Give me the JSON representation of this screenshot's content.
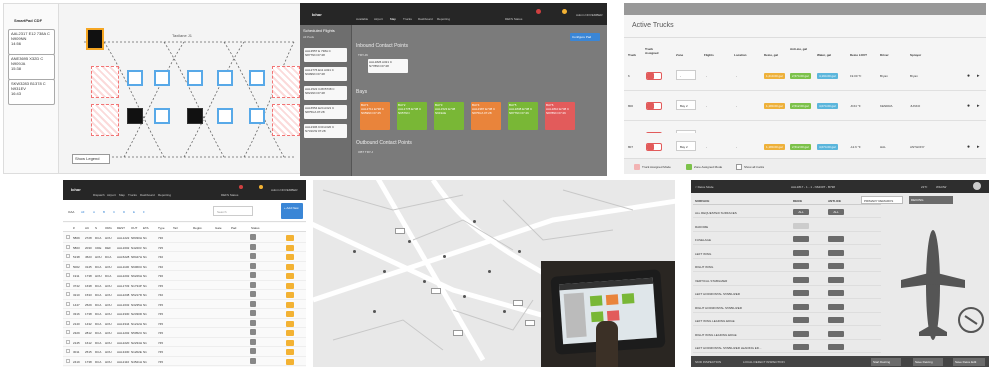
{
  "p1": {
    "title": "SmartPad CDF",
    "cards": [
      {
        "l1": "AAL2317 E12 738A C",
        "l2": "N909NN",
        "l3": "14:56"
      },
      {
        "l1": "ANE3695 X32D C",
        "l2": "N909JA",
        "l3": "15:38"
      },
      {
        "l1": "SKW3283 B1378 C",
        "l2": "N931EV",
        "l3": "16:43"
      }
    ],
    "taxi": "Taxilane J1",
    "legend": "Show Legend"
  },
  "p2": {
    "brand": "Ichor",
    "nav": [
      "Available",
      "Airport",
      "Map",
      "Trucks",
      "Dashboard",
      "Reporting"
    ],
    "user": "Admin NOVEMBER",
    "status": "DEFS Status",
    "sched_title": "Scheduled Flights",
    "sched_sub": "All Pads",
    "flights": [
      {
        "a": "AAL3557 E 738A C",
        "b": "N877NN 07:28"
      },
      {
        "a": "AAL2776 E11 A321 C",
        "b": "N909NN 07:28"
      },
      {
        "a": "AAL1522 C28 B738 C",
        "b": "N821NN 07:28"
      },
      {
        "a": "AAL6554 E24 A321 C",
        "b": "N875UA 07:28"
      },
      {
        "a": "AAL2306 K30 A320 C",
        "b": "N731UW 07:28"
      }
    ],
    "inbound": "Inbound Contact Points",
    "cp": "TRY-J6",
    "cp_card": {
      "a": "AAL1826 A321 C",
      "b": "N778NN 07:28"
    },
    "bays_title": "Bays",
    "bays": [
      {
        "name": "BAY1",
        "a": "AAL2711 E738 C",
        "b": "N959NN 07:25",
        "color": "#e9843b"
      },
      {
        "name": "BAY2",
        "a": "AAL1778 E738 C",
        "b": "N957NN",
        "color": "#79b736"
      },
      {
        "name": "BAY3",
        "a": "AAL1523 E738",
        "b": "N919AE",
        "color": "#79b736"
      },
      {
        "name": "BAY4",
        "a": "AAL2387 E738 C",
        "b": "N875UA 07:28",
        "color": "#e9843b"
      },
      {
        "name": "BAY5",
        "a": "AAL1838 E738 C",
        "b": "N877NN 07:26",
        "color": "#79b736"
      },
      {
        "name": "BAY6",
        "a": "AAL1810 E738 C",
        "b": "N878NN 07:26",
        "color": "#e25b5b"
      }
    ],
    "outbound": "Outbound Contact Points",
    "out_cp": "OBT TRY-J",
    "config": "Configure Pad"
  },
  "p3": {
    "title": "Active Trucks",
    "headers": [
      "Truck",
      "Truck Assigned",
      "Zone",
      "Flights",
      "Location",
      "Deice, gal",
      "Anti-ice, gal",
      "Water, gal",
      "Deice LOUT",
      "Driver",
      "Sprayer"
    ],
    "rows": [
      {
        "truck": "6",
        "zone": "-",
        "flights": "-",
        "location": "-",
        "deice": "1,210.00 gal",
        "anti": "2,574.00 gal",
        "water": "4,194.00 gal",
        "lout": "19.00 °F",
        "driver": "Bryan",
        "sprayer": "Bryan"
      },
      {
        "truck": "800",
        "zone": "Bay 2",
        "flights": "-",
        "location": "-",
        "deice": "1,180.00 gal",
        "anti": "2,512.00 gal",
        "water": "4,074.00 gal",
        "lout": "-8.64 °F",
        "driver": "KENDRA",
        "sprayer": "JUNKO"
      },
      {
        "truck": "805",
        "zone": "Bay 2",
        "flights": "-",
        "location": "-",
        "deice": "1,180.00 gal",
        "anti": "2,512.00 gal",
        "water": "4,074.00 gal",
        "lout": "-12.6 °F",
        "driver": "JJ",
        "sprayer": "LUIS"
      },
      {
        "truck": "807",
        "zone": "Bay 2",
        "flights": "-",
        "location": "-",
        "deice": "1,180.00 gal",
        "anti": "2,512.00 gal",
        "water": "4,074.00 gal",
        "lout": "-12.6 °F",
        "driver": "HAL",
        "sprayer": "ANTHONY"
      }
    ],
    "footer": [
      "Truck Assigned Mode",
      "Zone Assigned Mode",
      "Show all trucks"
    ],
    "colors": {
      "red": "#e25b5b",
      "orange": "#eeb13a",
      "green": "#7cc24a",
      "blue": "#5bb6dc"
    }
  },
  "p4": {
    "brand": "Ichor",
    "nav": [
      "Dispatch",
      "Airport",
      "Map",
      "Trucks",
      "Dashboard",
      "Reporting"
    ],
    "user": "Admin NOVEMBER",
    "status": "DEFS Status",
    "filters": [
      "OAA",
      "All",
      "A",
      "B",
      "C",
      "D",
      "E",
      "F"
    ],
    "search": "Search",
    "new_btn": "+ Add New",
    "headers": [
      "#",
      "AC",
      "S",
      "ORG",
      "DEST",
      "OUT",
      "ETA",
      "Type",
      "Tail",
      "Regist.",
      "Gate",
      "Pad",
      "Status"
    ],
    "rows": [
      [
        "5809",
        "2728",
        "DCA",
        "HOU",
        "AAL1222",
        "N8330H",
        "N1",
        "736"
      ],
      [
        "5803",
        "2030",
        "CDE",
        "DEF",
        "AAL1602",
        "N42203",
        "N1",
        "725"
      ],
      [
        "5138",
        "4523",
        "HOU",
        "DCA",
        "AAL5228",
        "N8447H",
        "N1",
        "740"
      ],
      [
        "5002",
        "3145",
        "DCA",
        "HOU",
        "AAL1100",
        "N6060U",
        "N1",
        "740"
      ],
      [
        "1911",
        "1738",
        "HOU",
        "DCA",
        "AAL2202",
        "N6226H",
        "N1",
        "736"
      ],
      [
        "3742",
        "1638",
        "DCA",
        "HOU",
        "AAL1733",
        "N1734P",
        "N1",
        "745"
      ],
      [
        "3210",
        "1533",
        "DCA",
        "HOU",
        "AAL2238",
        "N5217D",
        "N1",
        "740"
      ],
      [
        "1447",
        "2529",
        "DCA",
        "HOU",
        "AAL1632",
        "N3235H",
        "N1",
        "745"
      ],
      [
        "3316",
        "1738",
        "DCA",
        "HOU",
        "AAL3330",
        "N2330D",
        "N1",
        "745"
      ],
      [
        "2140",
        "1432",
        "DCA",
        "HOU",
        "AAL3344",
        "N1212H",
        "N1",
        "745"
      ],
      [
        "2329",
        "2812",
        "DCA",
        "HOU",
        "AAL1202",
        "N5052U",
        "N1",
        "745"
      ],
      [
        "2145",
        "1612",
        "DCA",
        "HOU",
        "AAL2220",
        "N2234H",
        "N1",
        "745"
      ],
      [
        "3011",
        "2515",
        "DCA",
        "HOU",
        "AAL3430",
        "N1202E",
        "N1",
        "745"
      ],
      [
        "2419",
        "1738",
        "DCA",
        "HOU",
        "AAL2110",
        "N4521H",
        "N1",
        "745"
      ]
    ]
  },
  "p6": {
    "back": "< Deice Mode",
    "title": "AAL1817 - 1 - 1 - N6430T - B738",
    "temp": "21°F",
    "weight": "WILDW",
    "headers": [
      "SURFACE",
      "DEICE",
      "ANTI-ICE"
    ],
    "surfaces": [
      "ALL REQUESTED SURFACES",
      "RADOME",
      "FUSELAGE",
      "LEFT WING",
      "RIGHT WING",
      "VERTICAL STABILIZER",
      "LEFT HORIZONTAL STABILIZER",
      "RIGHT HORIZONTAL STABILIZER",
      "LEFT WING LEADING EDGE",
      "RIGHT WING LEADING EDGE",
      "LEFT HORIZONTAL STABILIZER LEADING ED..."
    ],
    "btn_all": "ALL",
    "btn_primary": "PRIMARY REMARKS",
    "btn_deicing": "DEICING",
    "bottom": [
      "SKID INSPECTION",
      "LOCAL DEFECT INSPECTION",
      "Start Deicing",
      "Save Deicing",
      "Save Deice Edit"
    ]
  }
}
